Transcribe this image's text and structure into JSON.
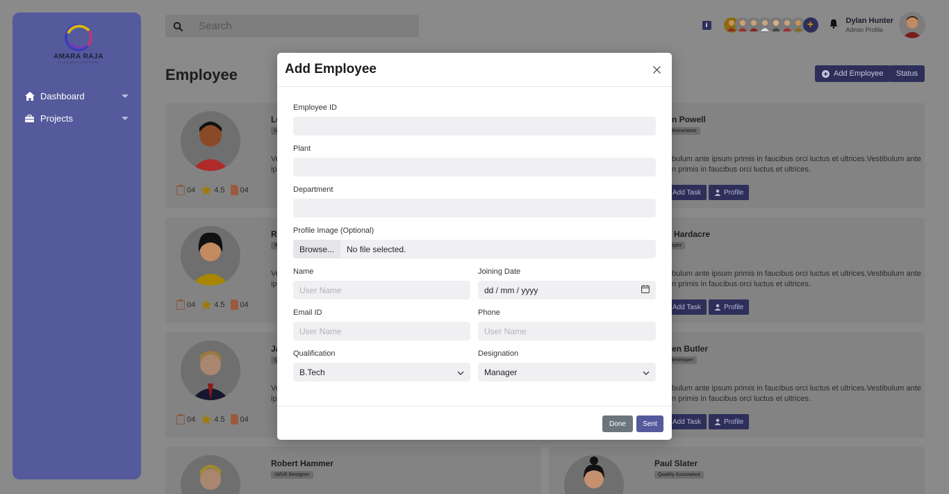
{
  "brand": {
    "name": "AMARA RAJA",
    "tagline": "EV & ENERGY SOLUTIONS"
  },
  "sidebar": {
    "items": [
      {
        "label": "Dashboard",
        "icon": "home-icon"
      },
      {
        "label": "Projects",
        "icon": "briefcase-icon"
      }
    ]
  },
  "topbar": {
    "search_placeholder": "Search",
    "user": {
      "name": "Dylan Hunter",
      "role": "Admin Profile"
    },
    "team_plus": "+"
  },
  "page": {
    "title": "Employee",
    "add_employee_label": "Add Employee",
    "status_label": "Status"
  },
  "cards": [
    {
      "name": "Lu",
      "badge": "U",
      "text_line1": "Ve",
      "text_line2": "ip",
      "tasks": "04",
      "rating": "4.5",
      "docs": "04"
    },
    {
      "name": "Ra",
      "badge": "W",
      "text_line1": "Ve",
      "text_line2": "ip",
      "tasks": "04",
      "rating": "4.5",
      "docs": "04"
    },
    {
      "name": "Ja",
      "badge": "Q",
      "text_line1": "Ve",
      "text_line2": "ip",
      "tasks": "04",
      "rating": "4.5",
      "docs": "04"
    },
    {
      "name": "Robert Hammer",
      "badge": "UI/UX Designer"
    },
    {
      "name": "n Powell",
      "badge": "ity Assurance",
      "text_line1": "bulum ante ipsum primis in faucibus orci luctus et ultrices.Vestibulum ante",
      "text_line2": "n primis in faucibus orci luctus et ultrices.",
      "add_task": "Add Task",
      "profile": "Profile"
    },
    {
      "name": "Hardacre",
      "badge": "loper",
      "text_line1": "bulum ante ipsum primis in faucibus orci luctus et ultrices.Vestibulum ante",
      "text_line2": "n primis in faucibus orci luctus et ultrices.",
      "add_task": "Add Task",
      "profile": "Profile"
    },
    {
      "name": "en Butler",
      "badge": "le developer",
      "text_line1": "bulum ante ipsum primis in faucibus orci luctus et ultrices.Vestibulum ante",
      "text_line2": "n primis in faucibus orci luctus et ultrices.",
      "add_task": "Add Task",
      "profile": "Profile"
    },
    {
      "name": "Paul Slater",
      "badge": "Quality Assurance"
    }
  ],
  "modal": {
    "title": "Add Employee",
    "fields": {
      "employee_id": {
        "label": "Employee ID",
        "value": ""
      },
      "plant": {
        "label": "Plant",
        "value": ""
      },
      "department": {
        "label": "Department",
        "value": ""
      },
      "profile_image": {
        "label": "Profile Image (Optional)",
        "browse": "Browse...",
        "status": "No file selected."
      },
      "name": {
        "label": "Name",
        "placeholder": "User Name"
      },
      "joining_date": {
        "label": "Joining Date",
        "value": "dd / mm / yyyy"
      },
      "email": {
        "label": "Email ID",
        "placeholder": "User Name"
      },
      "phone": {
        "label": "Phone",
        "placeholder": "User Name"
      },
      "qualification": {
        "label": "Qualification",
        "value": "B.Tech"
      },
      "designation": {
        "label": "Designation",
        "value": "Manager"
      }
    },
    "done_label": "Done",
    "sent_label": "Sent"
  },
  "colors": {
    "sidebar": "#545a9c",
    "primary": "#2d2f5a",
    "sent_button": "#545a9c",
    "done_button": "#6c757d",
    "overlay_bg": "#8a8a8a"
  }
}
